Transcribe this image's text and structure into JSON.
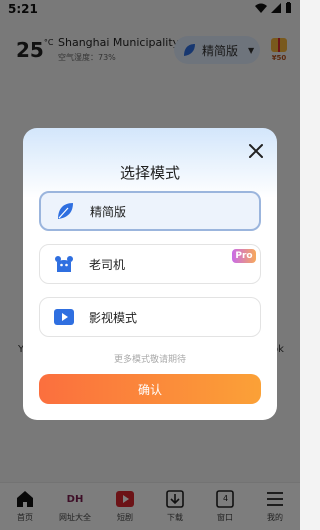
{
  "statusbar": {
    "time": "5:21"
  },
  "weather": {
    "temperature": "25",
    "unit": "°C",
    "city": "Shanghai Municipality",
    "humidity": "空气湿度：73%"
  },
  "mode_pill": {
    "label": "精简版"
  },
  "reward": {
    "label": "¥50"
  },
  "background_fragments": {
    "left": "Y",
    "right": "ok"
  },
  "tabbar": {
    "items": [
      {
        "label": "首页",
        "icon": "home-icon"
      },
      {
        "label": "网址大全",
        "icon": "dh-logo-icon",
        "logo_text": "DH"
      },
      {
        "label": "短剧",
        "icon": "play-icon"
      },
      {
        "label": "下载",
        "icon": "download-icon"
      },
      {
        "label": "窗口",
        "icon": "window-icon",
        "count": "4"
      },
      {
        "label": "我的",
        "icon": "menu-icon"
      }
    ]
  },
  "dialog": {
    "title": "选择模式",
    "options": [
      {
        "label": "精简版",
        "icon": "leaf-icon",
        "selected": true
      },
      {
        "label": "老司机",
        "icon": "mascot-icon",
        "badge": "Pro"
      },
      {
        "label": "影视模式",
        "icon": "video-play-icon"
      }
    ],
    "more_tip": "更多模式敬请期待",
    "confirm_label": "确认"
  },
  "colors": {
    "accent_blue": "#2f6fe0",
    "confirm_start": "#fb6f3e",
    "confirm_end": "#fba137",
    "pro_start": "#c86be8",
    "pro_end": "#f7a95b"
  }
}
